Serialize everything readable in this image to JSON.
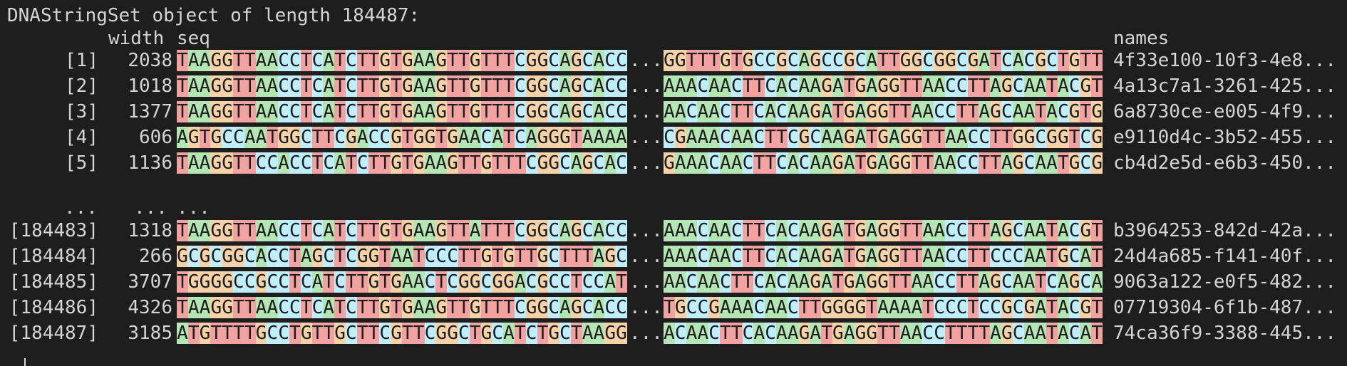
{
  "title": "DNAStringSet object of length 184487:",
  "headers": {
    "width": "width",
    "seq": "seq",
    "names": "names"
  },
  "ellipsis": "...",
  "gap": {
    "idx": "...",
    "width": "...",
    "seq": "..."
  },
  "colors": {
    "A": "#b3e6b3",
    "C": "#bfefff",
    "G": "#f6d2a8",
    "T": "#f3a2a2",
    "background": "#1e1e1e",
    "text": "#d4d4d4"
  },
  "rows": [
    {
      "idx": "[1]",
      "width": "2038",
      "seq_left": "TAAGGTTAACCTCATCTTGTGAAGTTGTTTCGGCAGCACC",
      "seq_right": "GGTTTGTGCCGCAGCCGCATTGGCGGCGATCACGCTGTT",
      "name": "4f33e100-10f3-4e8..."
    },
    {
      "idx": "[2]",
      "width": "1018",
      "seq_left": "TAAGGTTAACCTCATCTTGTGAAGTTGTTTCGGCAGCACC",
      "seq_right": "AAACAACTTCACAAGATGAGGTTAACCTTAGCAATACGT",
      "name": "4a13c7a1-3261-425..."
    },
    {
      "idx": "[3]",
      "width": "1377",
      "seq_left": "TAAGGTTAACCTCATCTTGTGAAGTTGTTTCGGCAGCACC",
      "seq_right": "AACAACTTCACAAGATGAGGTTAACCTTAGCAATACGTG",
      "name": "6a8730ce-e005-4f9..."
    },
    {
      "idx": "[4]",
      "width": "606",
      "seq_left": "AGTGCCAATGGCTTCGACCGTGGTGAACATCAGGGTAAAA",
      "seq_right": "CGAAACAACTTCGCAAGATGAGGTTAACCTTGGCGGTCG",
      "name": "e9110d4c-3b52-455..."
    },
    {
      "idx": "[5]",
      "width": "1136",
      "seq_left": "TAAGGTTCCACCTCATCTTGTGAAGTTGTTTCGGCAGCAC",
      "seq_right": "GAAACAACTTCACAAGATGAGGTTAACCTTAGCAATGCG",
      "name": "cb4d2e5d-e6b3-450..."
    },
    {
      "idx": "[184483]",
      "width": "1318",
      "seq_left": "TAAGGTTAACCTCATCTTGTGAAGTTATTTCGGCAGCACC",
      "seq_right": "AAACAACTTCACAAGATGAGGTTAACCTTAGCAATACGT",
      "name": "b3964253-842d-42a..."
    },
    {
      "idx": "[184484]",
      "width": "266",
      "seq_left": "GCGCGGCACCTAGCTCGGTAATCCCTTGTGTTGCTTTAGC",
      "seq_right": "AAACAACTTCACAAGATGAGGTTAACCTTCCCAATGCAT",
      "name": "24d4a685-f141-40f..."
    },
    {
      "idx": "[184485]",
      "width": "3707",
      "seq_left": "TGGGGCCGCCTCATCTTGTGAACTCGGCGGACGCCTCCAT",
      "seq_right": "AACAACTTCACAAGATGAGGTTAACCTTAGCAATCAGCA",
      "name": "9063a122-e0f5-482..."
    },
    {
      "idx": "[184486]",
      "width": "4326",
      "seq_left": "TAAGGTTAACCTCATCTTGTGAAGTTGTTTCGGCAGCACC",
      "seq_right": "TGCCGAAACAACTTGGGGTAAAATCCCTCCGCGATACGT",
      "name": "07719304-6f1b-487..."
    },
    {
      "idx": "[184487]",
      "width": "3185",
      "seq_left": "ATGTTTTGCCTGTTGCTTCGTTCGGCTGCATCTGCTAAGG",
      "seq_right": "ACAACTTCACAAGATGAGGTTAACCTTTTAGCAATACAT",
      "name": "74ca36f9-3388-445..."
    }
  ]
}
